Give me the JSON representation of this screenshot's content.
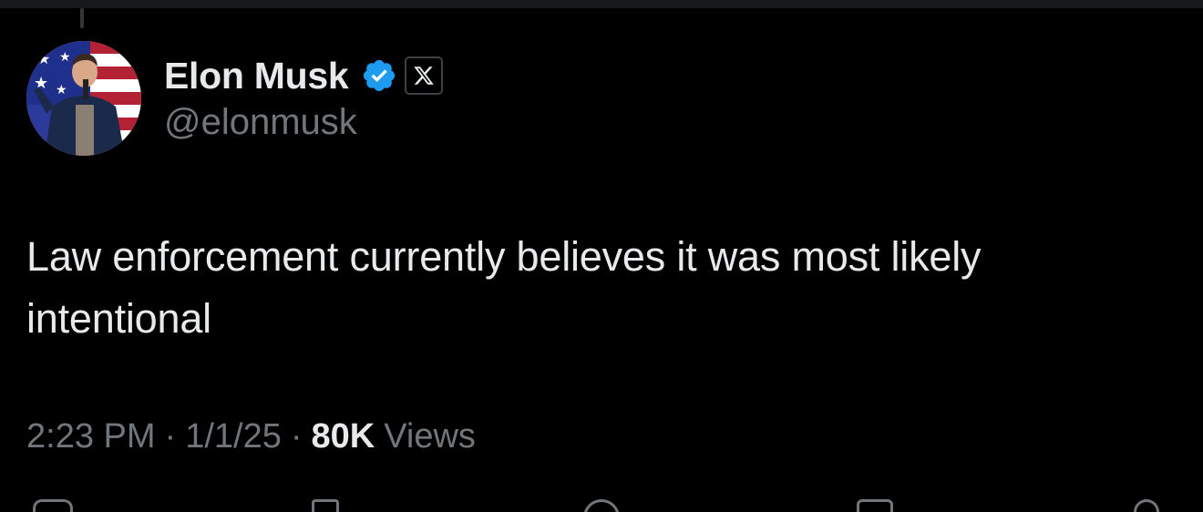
{
  "author": {
    "display_name": "Elon Musk",
    "handle": "@elonmusk",
    "verified_icon": "verified-badge-icon",
    "affiliate_icon": "x-logo-icon",
    "accent_color": "#1d9bf0"
  },
  "tweet": {
    "text": "Law enforcement currently believes it was most likely intentional"
  },
  "meta": {
    "time": "2:23 PM",
    "separator": "·",
    "date": "1/1/25",
    "views_count": "80K",
    "views_label": "Views"
  },
  "actions": [
    {
      "icon": "reply-icon"
    },
    {
      "icon": "retweet-icon"
    },
    {
      "icon": "like-icon"
    },
    {
      "icon": "bookmark-icon"
    },
    {
      "icon": "share-icon"
    }
  ]
}
